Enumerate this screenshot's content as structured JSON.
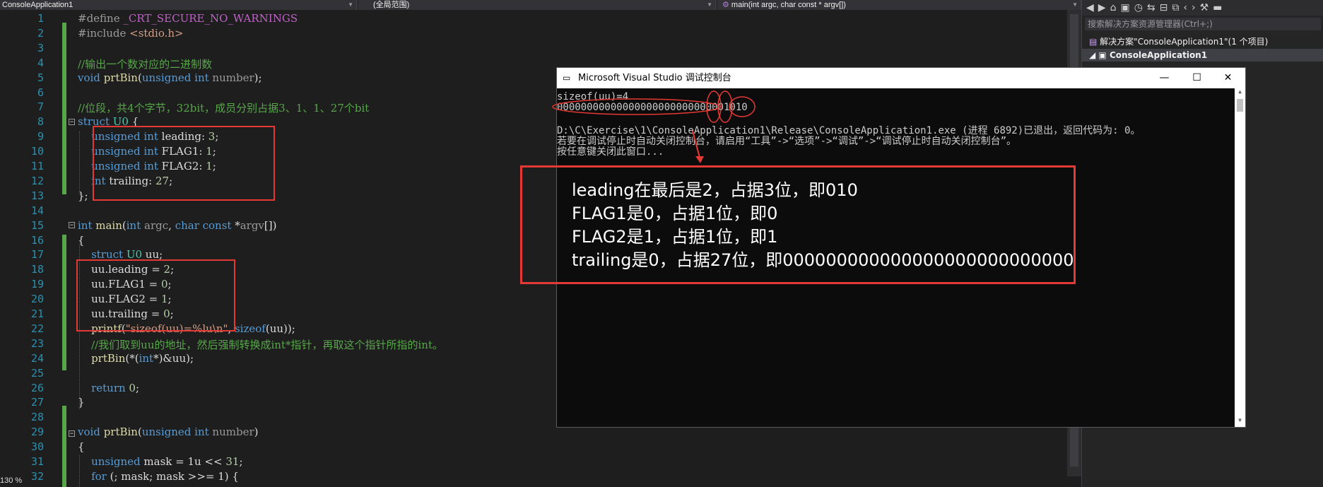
{
  "navbar": {
    "project": "ConsoleApplication1",
    "scope": "(全局范围)",
    "function": "main(int argc, char const * argv[])"
  },
  "editor": {
    "zoom": "130 %",
    "lines": [
      {
        "n": "1",
        "segs": [
          [
            "pp",
            "#define "
          ],
          [
            "mac",
            "_CRT_SECURE_NO_WARNINGS"
          ]
        ]
      },
      {
        "n": "2",
        "segs": [
          [
            "pp",
            "#include "
          ],
          [
            "str",
            "<stdio.h>"
          ]
        ]
      },
      {
        "n": "3",
        "segs": []
      },
      {
        "n": "4",
        "segs": [
          [
            "cm",
            "//输出一个数对应的二进制数"
          ]
        ]
      },
      {
        "n": "5",
        "segs": [
          [
            "kw",
            "void "
          ],
          [
            "fn",
            "prtBin"
          ],
          [
            "",
            "("
          ],
          [
            "kw",
            "unsigned int "
          ],
          [
            "par",
            "number"
          ],
          [
            "",
            ");"
          ]
        ]
      },
      {
        "n": "6",
        "segs": []
      },
      {
        "n": "7",
        "segs": [
          [
            "cm",
            "//位段，共4个字节，32bit，成员分别占据3、1、1、27个bit"
          ]
        ]
      },
      {
        "n": "8",
        "segs": [
          [
            "kw",
            "struct "
          ],
          [
            "ty",
            "U0"
          ],
          [
            "",
            " {"
          ]
        ]
      },
      {
        "n": "9",
        "segs": [
          [
            "",
            "    "
          ],
          [
            "kw",
            "unsigned int "
          ],
          [
            "",
            "leading: "
          ],
          [
            "num",
            "3"
          ],
          [
            "",
            ";"
          ]
        ]
      },
      {
        "n": "10",
        "segs": [
          [
            "",
            "    "
          ],
          [
            "kw",
            "unsigned int "
          ],
          [
            "",
            "FLAG1: "
          ],
          [
            "num",
            "1"
          ],
          [
            "",
            ";"
          ]
        ]
      },
      {
        "n": "11",
        "segs": [
          [
            "",
            "    "
          ],
          [
            "kw",
            "unsigned int "
          ],
          [
            "",
            "FLAG2: "
          ],
          [
            "num",
            "1"
          ],
          [
            "",
            ";"
          ]
        ]
      },
      {
        "n": "12",
        "segs": [
          [
            "",
            "    "
          ],
          [
            "kw",
            "int "
          ],
          [
            "",
            "trailing: "
          ],
          [
            "num",
            "27"
          ],
          [
            "",
            ";"
          ]
        ]
      },
      {
        "n": "13",
        "segs": [
          [
            "",
            "};"
          ]
        ]
      },
      {
        "n": "14",
        "segs": []
      },
      {
        "n": "15",
        "segs": [
          [
            "kw",
            "int "
          ],
          [
            "fn",
            "main"
          ],
          [
            "",
            "("
          ],
          [
            "kw",
            "int "
          ],
          [
            "par",
            "argc"
          ],
          [
            "",
            ", "
          ],
          [
            "kw",
            "char const "
          ],
          [
            "",
            "*"
          ],
          [
            "par",
            "argv"
          ],
          [
            "",
            "[])"
          ]
        ]
      },
      {
        "n": "16",
        "segs": [
          [
            "",
            "{"
          ]
        ]
      },
      {
        "n": "17",
        "segs": [
          [
            "",
            "    "
          ],
          [
            "kw",
            "struct "
          ],
          [
            "ty",
            "U0 "
          ],
          [
            "",
            "uu;"
          ]
        ]
      },
      {
        "n": "18",
        "segs": [
          [
            "",
            "    uu.leading = "
          ],
          [
            "num",
            "2"
          ],
          [
            "",
            ";"
          ]
        ]
      },
      {
        "n": "19",
        "segs": [
          [
            "",
            "    uu.FLAG1 = "
          ],
          [
            "num",
            "0"
          ],
          [
            "",
            ";"
          ]
        ]
      },
      {
        "n": "20",
        "segs": [
          [
            "",
            "    uu.FLAG2 = "
          ],
          [
            "num",
            "1"
          ],
          [
            "",
            ";"
          ]
        ]
      },
      {
        "n": "21",
        "segs": [
          [
            "",
            "    uu.trailing = "
          ],
          [
            "num",
            "0"
          ],
          [
            "",
            ";"
          ]
        ]
      },
      {
        "n": "22",
        "segs": [
          [
            "",
            "    "
          ],
          [
            "fn",
            "printf"
          ],
          [
            "",
            "("
          ],
          [
            "str",
            "\"sizeof(uu)=%lu\\n\""
          ],
          [
            "",
            ", "
          ],
          [
            "kw",
            "sizeof"
          ],
          [
            "",
            "(uu));"
          ]
        ]
      },
      {
        "n": "23",
        "segs": [
          [
            "",
            "    "
          ],
          [
            "cm",
            "//我们取到uu的地址，然后强制转换成int*指针，再取这个指针所指的int。"
          ]
        ]
      },
      {
        "n": "24",
        "segs": [
          [
            "",
            "    "
          ],
          [
            "fn",
            "prtBin"
          ],
          [
            "",
            "(*("
          ],
          [
            "kw",
            "int"
          ],
          [
            "",
            "*)&uu);"
          ]
        ]
      },
      {
        "n": "25",
        "segs": []
      },
      {
        "n": "26",
        "segs": [
          [
            "",
            "    "
          ],
          [
            "kw",
            "return "
          ],
          [
            "num",
            "0"
          ],
          [
            "",
            ";"
          ]
        ]
      },
      {
        "n": "27",
        "segs": [
          [
            "",
            "}"
          ]
        ]
      },
      {
        "n": "28",
        "segs": []
      },
      {
        "n": "29",
        "segs": [
          [
            "kw",
            "void "
          ],
          [
            "fn",
            "prtBin"
          ],
          [
            "",
            "("
          ],
          [
            "kw",
            "unsigned int "
          ],
          [
            "par",
            "number"
          ],
          [
            "",
            ")"
          ]
        ]
      },
      {
        "n": "30",
        "segs": [
          [
            "",
            "{"
          ]
        ]
      },
      {
        "n": "31",
        "segs": [
          [
            "",
            "    "
          ],
          [
            "kw",
            "unsigned "
          ],
          [
            "",
            "mask = 1u << "
          ],
          [
            "num",
            "31"
          ],
          [
            "",
            ";"
          ]
        ]
      },
      {
        "n": "32",
        "segs": [
          [
            "",
            "    "
          ],
          [
            "kw",
            "for "
          ],
          [
            "",
            "(; mask; mask >>= 1) {"
          ]
        ]
      }
    ]
  },
  "solution": {
    "search_placeholder": "搜索解决方案资源管理器(Ctrl+;)",
    "solution_label": "解决方案\"ConsoleApplication1\"(1 个项目)",
    "project_label": "ConsoleApplication1"
  },
  "console": {
    "title": "Microsoft Visual Studio 调试控制台",
    "lines": [
      "sizeof(uu)=4",
      "00000000000000000000000000001010",
      "",
      "D:\\C\\Exercise\\1\\ConsoleApplication1\\Release\\ConsoleApplication1.exe (进程 6892)已退出，返回代码为: 0。",
      "若要在调试停止时自动关闭控制台，请启用“工具”->“选项”->“调试”->“调试停止时自动关闭控制台”。",
      "按任意键关闭此窗口..."
    ]
  },
  "annotation": {
    "lines": [
      "leading在最后是2，占据3位，即010",
      "FLAG1是0，占据1位，即0",
      "FLAG2是1，占据1位，即1",
      "trailing是0，占据27位，即000000000000000000000000000"
    ]
  }
}
